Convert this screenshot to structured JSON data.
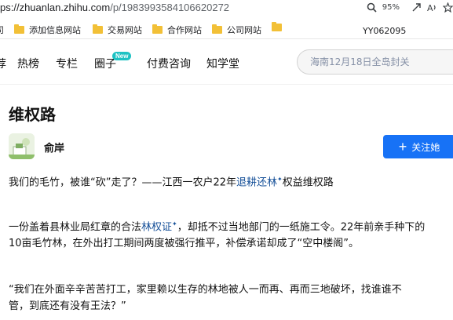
{
  "browser": {
    "url_prefix": "ps://zhuanlan.zhihu.com",
    "url_path": "/p/1983993584106620272",
    "zoom": "95%"
  },
  "bookmarks": {
    "items": [
      "司",
      "添加信息网站",
      "交易网站",
      "合作网站",
      "公司网站"
    ],
    "extra": "YY062095"
  },
  "nav": {
    "items": [
      "荐",
      "热榜",
      "专栏",
      "圈子",
      "付费咨询",
      "知学堂"
    ],
    "new_badge": "New",
    "search_placeholder": "海南12月18日全岛封关"
  },
  "column": {
    "title": "维权路"
  },
  "author": {
    "name": "俞岸",
    "follow_label": "关注她"
  },
  "article": {
    "p1_a": "我们的毛竹，被谁“砍”走了？——江西一农户22年",
    "p1_link": "退耕还林",
    "p1_b": "权益维权路",
    "p2_a": "一份盖着县林业局红章的合法",
    "p2_link": "林权证",
    "p2_b": "，却抵不过当地部门的一纸施工令。22年前亲手种下的",
    "p2_c": "10亩毛竹林，在外出打工期间两度被强行推平，补偿承诺却成了“空中楼阁”。",
    "p3_a": "“我们在外面辛辛苦苦打工，家里赖以生存的林地被人一而再、再而三地破坏，找谁谁不",
    "p3_b": "管，到底还有没有王法？”"
  }
}
